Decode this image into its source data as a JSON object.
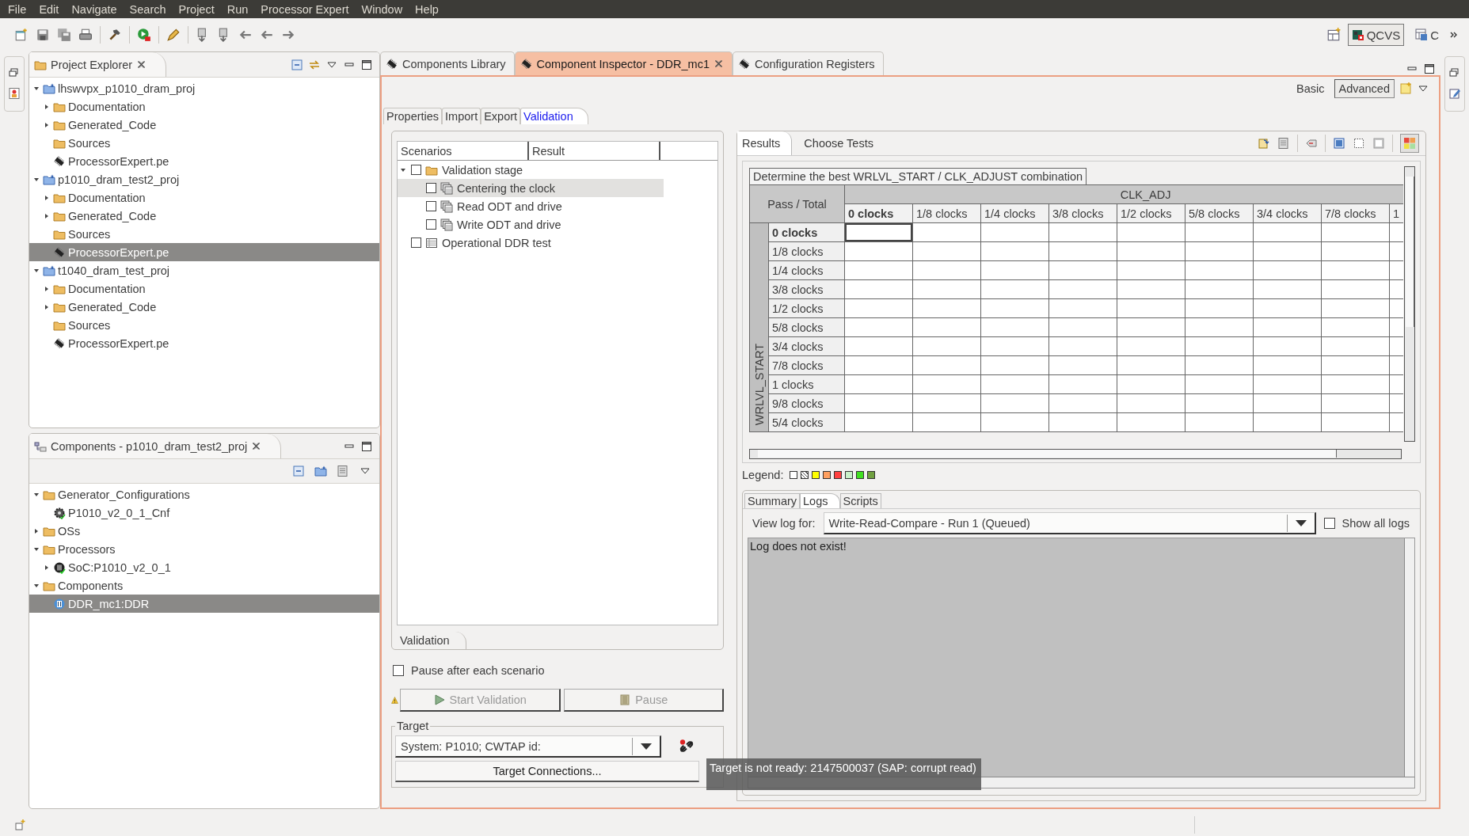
{
  "menu_bar": [
    "File",
    "Edit",
    "Navigate",
    "Search",
    "Project",
    "Run",
    "Processor Expert",
    "Window",
    "Help"
  ],
  "perspectives": [
    {
      "label": "QCVS",
      "selected": true
    },
    {
      "label": "C",
      "selected": false
    }
  ],
  "project_explorer": {
    "title": "Project Explorer",
    "items": [
      {
        "label": "lhswvpx_p1010_dram_proj",
        "kind": "project",
        "expanded": true,
        "selected": false,
        "children": [
          {
            "label": "Documentation",
            "kind": "folder",
            "expanded": false,
            "selected": false
          },
          {
            "label": "Generated_Code",
            "kind": "folder",
            "expanded": false,
            "selected": false
          },
          {
            "label": "Sources",
            "kind": "folder",
            "selected": false
          },
          {
            "label": "ProcessorExpert.pe",
            "kind": "chip",
            "selected": false
          }
        ]
      },
      {
        "label": "p1010_dram_test2_proj",
        "kind": "project",
        "expanded": true,
        "selected": false,
        "children": [
          {
            "label": "Documentation",
            "kind": "folder",
            "expanded": false,
            "selected": false
          },
          {
            "label": "Generated_Code",
            "kind": "folder",
            "expanded": false,
            "selected": false
          },
          {
            "label": "Sources",
            "kind": "folder",
            "selected": false
          },
          {
            "label": "ProcessorExpert.pe",
            "kind": "chip",
            "selected": true
          }
        ]
      },
      {
        "label": "t1040_dram_test_proj",
        "kind": "project",
        "expanded": true,
        "selected": false,
        "children": [
          {
            "label": "Documentation",
            "kind": "folder",
            "expanded": false,
            "selected": false
          },
          {
            "label": "Generated_Code",
            "kind": "folder",
            "expanded": false,
            "selected": false
          },
          {
            "label": "Sources",
            "kind": "folder",
            "selected": false
          },
          {
            "label": "ProcessorExpert.pe",
            "kind": "chip",
            "selected": false
          }
        ]
      }
    ]
  },
  "components_view": {
    "title": "Components - p1010_dram_test2_proj",
    "items": [
      {
        "label": "Generator_Configurations",
        "kind": "folder",
        "expanded": true,
        "selected": false,
        "children": [
          {
            "label": "P1010_v2_0_1_Cnf",
            "kind": "gear",
            "selected": false
          }
        ]
      },
      {
        "label": "OSs",
        "kind": "folder",
        "expanded": false,
        "selected": false
      },
      {
        "label": "Processors",
        "kind": "folder",
        "expanded": true,
        "selected": false,
        "children": [
          {
            "label": "SoC:P1010_v2_0_1",
            "kind": "cpu",
            "expanded": false,
            "selected": false
          }
        ]
      },
      {
        "label": "Components",
        "kind": "folder",
        "expanded": true,
        "selected": false,
        "children": [
          {
            "label": "DDR_mc1:DDR",
            "kind": "module",
            "selected": true
          }
        ]
      }
    ]
  },
  "editor_tabs": [
    {
      "label": "Components Library",
      "selected": false,
      "closable": false
    },
    {
      "label": "Component Inspector - DDR_mc1",
      "selected": true,
      "closable": true
    },
    {
      "label": "Configuration Registers",
      "selected": false,
      "closable": false
    }
  ],
  "mode_buttons": [
    {
      "label": "Basic",
      "selected": false
    },
    {
      "label": "Advanced",
      "selected": true
    }
  ],
  "inspector_tabs": [
    {
      "label": "Properties",
      "selected": false
    },
    {
      "label": "Import",
      "selected": false
    },
    {
      "label": "Export",
      "selected": false
    },
    {
      "label": "Validation",
      "selected": true
    }
  ],
  "scenarios": {
    "columns": [
      "Scenarios",
      "Result"
    ],
    "items": [
      {
        "label": "Validation stage",
        "kind": "folder",
        "expanded": true,
        "checked": false,
        "selected": false,
        "children": [
          {
            "label": "Centering the clock",
            "kind": "stack",
            "checked": false,
            "selected": true
          },
          {
            "label": "Read ODT and drive",
            "kind": "stack",
            "checked": false,
            "selected": false
          },
          {
            "label": "Write ODT and drive",
            "kind": "stack",
            "checked": false,
            "selected": false
          }
        ]
      },
      {
        "label": "Operational DDR test",
        "kind": "table",
        "checked": false,
        "selected": false
      }
    ],
    "bottom_tab": "Validation"
  },
  "pause_after_each": {
    "label": "Pause after each scenario",
    "checked": false
  },
  "actions": [
    {
      "label": "Start Validation",
      "kind": "play",
      "disabled": true
    },
    {
      "label": "Pause",
      "kind": "pause",
      "disabled": true
    }
  ],
  "target": {
    "legend": "Target",
    "system": "System: P1010; CWTAP id:",
    "connections_button": "Target Connections..."
  },
  "results_tabs": [
    {
      "label": "Results",
      "selected": true
    },
    {
      "label": "Choose Tests",
      "selected": false
    }
  ],
  "grid": {
    "title": "Determine the best WRLVL_START / CLK_ADJUST combination",
    "corner": "Pass / Total",
    "column_axis": "CLK_ADJ",
    "row_axis": "WRLVL_START",
    "columns": [
      {
        "label": "0 clocks",
        "selected": true
      },
      {
        "label": "1/8 clocks",
        "selected": false
      },
      {
        "label": "1/4 clocks",
        "selected": false
      },
      {
        "label": "3/8 clocks",
        "selected": false
      },
      {
        "label": "1/2 clocks",
        "selected": false
      },
      {
        "label": "5/8 clocks",
        "selected": false
      },
      {
        "label": "3/4 clocks",
        "selected": false
      },
      {
        "label": "7/8 clocks",
        "selected": false
      },
      {
        "label": "1",
        "selected": false
      }
    ],
    "rows": [
      {
        "label": "0 clocks",
        "selected": true
      },
      {
        "label": "1/8 clocks",
        "selected": false
      },
      {
        "label": "1/4 clocks",
        "selected": false
      },
      {
        "label": "3/8 clocks",
        "selected": false
      },
      {
        "label": "1/2 clocks",
        "selected": false
      },
      {
        "label": "5/8 clocks",
        "selected": false
      },
      {
        "label": "3/4 clocks",
        "selected": false
      },
      {
        "label": "7/8 clocks",
        "selected": false
      },
      {
        "label": "1 clocks",
        "selected": false
      },
      {
        "label": "9/8 clocks",
        "selected": false
      },
      {
        "label": "5/4 clocks",
        "selected": false
      }
    ]
  },
  "legend": {
    "label": "Legend:",
    "items": [
      {
        "kind": "plain",
        "color": "#ffffff"
      },
      {
        "kind": "hatched",
        "color": "#ffffff"
      },
      {
        "kind": "plain",
        "color": "#ffff00"
      },
      {
        "kind": "plain",
        "color": "#ffa060"
      },
      {
        "kind": "plain",
        "color": "#ff4040"
      },
      {
        "kind": "plain",
        "color": "#c8f0c8"
      },
      {
        "kind": "plain",
        "color": "#40e020"
      },
      {
        "kind": "plain",
        "color": "#70a040"
      }
    ]
  },
  "log_tabs": [
    {
      "label": "Summary",
      "selected": false
    },
    {
      "label": "Logs",
      "selected": true
    },
    {
      "label": "Scripts",
      "selected": false
    }
  ],
  "view_log": {
    "label": "View log for:",
    "value": "Write-Read-Compare - Run 1 (Queued)"
  },
  "show_all_logs": {
    "label": "Show all logs",
    "checked": false
  },
  "log_text": "Log does not exist!",
  "tooltip": "Target is not ready: 2147500037 (SAP: corrupt read)"
}
